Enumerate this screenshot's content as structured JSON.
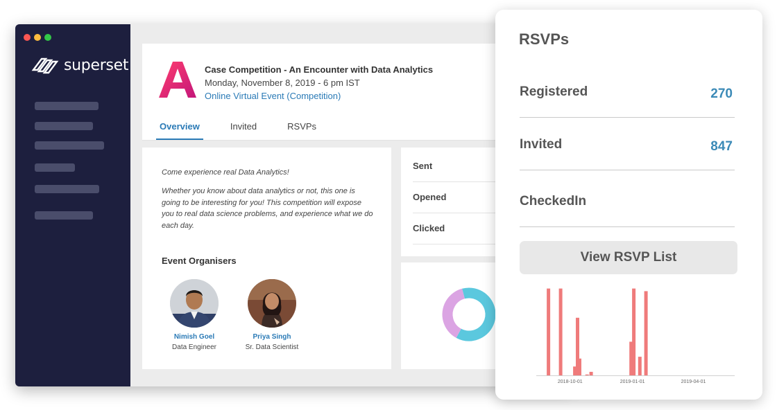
{
  "app": {
    "name": "superset",
    "colors": {
      "sidebar": "#1d1f3e",
      "accent": "#2a7ab6",
      "metric_value": "#3b8ab7",
      "bar": "#ef7b7b",
      "donut_primary": "#5bc8de",
      "donut_secondary": "#dba4e3",
      "event_logo": "#e6245b"
    }
  },
  "sidebar": {
    "nav_items": [
      "",
      "",
      "",
      "",
      "",
      ""
    ]
  },
  "event": {
    "title": "Case Competition - An Encounter with Data Analytics",
    "date": "Monday, November 8, 2019 - 6 pm IST",
    "type": "Online Virtual Event (Competition)",
    "logo_letter": "A"
  },
  "tabs": [
    {
      "label": "Overview",
      "active": true
    },
    {
      "label": "Invited",
      "active": false
    },
    {
      "label": "RSVPs",
      "active": false
    }
  ],
  "overview": {
    "intro": "Come experience real Data Analytics!",
    "description": "Whether you know about data analytics or not, this one is going to be interesting for you! This competition will expose you to real data science problems, and experience what we do each day.",
    "organisers_title": "Event Organisers",
    "organisers": [
      {
        "name": "Nimish Goel",
        "role": "Data Engineer",
        "icon": "person-avatar-icon"
      },
      {
        "name": "Priya Singh",
        "role": "Sr. Data Scientist",
        "icon": "person-avatar-icon"
      }
    ]
  },
  "email_stats": {
    "rows": [
      "Sent",
      "Opened",
      "Clicked"
    ]
  },
  "donut": {
    "values": [
      0.62,
      0.38
    ]
  },
  "rsvp": {
    "title": "RSVPs",
    "metrics": [
      {
        "label": "Registered",
        "value": "270"
      },
      {
        "label": "Invited",
        "value": "847"
      },
      {
        "label": "CheckedIn",
        "value": ""
      }
    ],
    "button_label": "View RSVP List"
  },
  "chart_data": {
    "type": "bar",
    "title": "",
    "x_ticks": [
      "2018-10-01",
      "2019-01-01",
      "2019-04-01"
    ],
    "x_range": [
      "2018-08-12",
      "2019-06-01"
    ],
    "ylim": [
      0,
      100
    ],
    "grid": false,
    "points": [
      {
        "x": "2018-08-30",
        "y": 98
      },
      {
        "x": "2018-09-17",
        "y": 98
      },
      {
        "x": "2018-10-08",
        "y": 10
      },
      {
        "x": "2018-10-12",
        "y": 65
      },
      {
        "x": "2018-10-15",
        "y": 19
      },
      {
        "x": "2018-10-26",
        "y": 1
      },
      {
        "x": "2018-11-01",
        "y": 4
      },
      {
        "x": "2018-12-30",
        "y": 38
      },
      {
        "x": "2019-01-03",
        "y": 98
      },
      {
        "x": "2019-01-12",
        "y": 21
      },
      {
        "x": "2019-01-21",
        "y": 95
      }
    ]
  }
}
